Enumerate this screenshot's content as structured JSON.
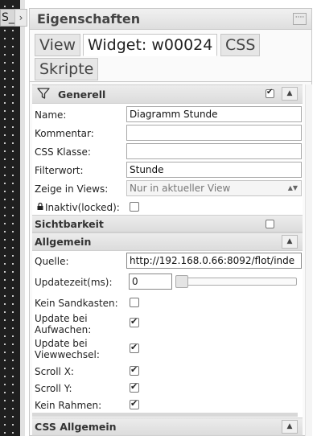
{
  "left": {
    "tab_text": "S_",
    "collapse_glyph": "›"
  },
  "panel": {
    "title": "Eigenschaften",
    "header_button": "····"
  },
  "tabs": [
    {
      "label": "View"
    },
    {
      "label": "Widget: w00024"
    },
    {
      "label": "CSS"
    },
    {
      "label": "Skripte"
    }
  ],
  "groups": {
    "generell": {
      "label": "Generell",
      "checked": true,
      "caret": "▲"
    },
    "sichtbarkeit": {
      "label": "Sichtbarkeit",
      "checked": false
    },
    "allgemein": {
      "label": "Allgemein",
      "caret": "▲"
    },
    "css_allgemein": {
      "label": "CSS Allgemein",
      "caret": "▲"
    }
  },
  "fields": {
    "name": {
      "label": "Name:",
      "value": "Diagramm Stunde"
    },
    "kommentar": {
      "label": "Kommentar:",
      "value": ""
    },
    "css_klasse": {
      "label": "CSS Klasse:",
      "value": ""
    },
    "filterwort": {
      "label": "Filterwort:",
      "value": "Stunde"
    },
    "zeige_in_views": {
      "label": "Zeige in Views:",
      "value": "Nur in aktueller View"
    },
    "inaktiv": {
      "label": "Inaktiv(locked):",
      "checked": false
    },
    "quelle": {
      "label": "Quelle:",
      "value": "http://192.168.0.66:8092/flot/inde"
    },
    "updatezeit": {
      "label": "Updatezeit(ms):",
      "value": "0",
      "slider_level": 0
    },
    "kein_sandkasten": {
      "label": "Kein Sandkasten:",
      "checked": false
    },
    "update_aufwachen": {
      "label_line1": "Update bei",
      "label_line2": "Aufwachen:",
      "checked": true
    },
    "update_viewwechsel": {
      "label_line1": "Update bei",
      "label_line2": "Viewwechsel:",
      "checked": true
    },
    "scroll_x": {
      "label": "Scroll X:",
      "checked": true
    },
    "scroll_y": {
      "label": "Scroll Y:",
      "checked": true
    },
    "kein_rahmen": {
      "label": "Kein Rahmen:",
      "checked": true
    }
  }
}
